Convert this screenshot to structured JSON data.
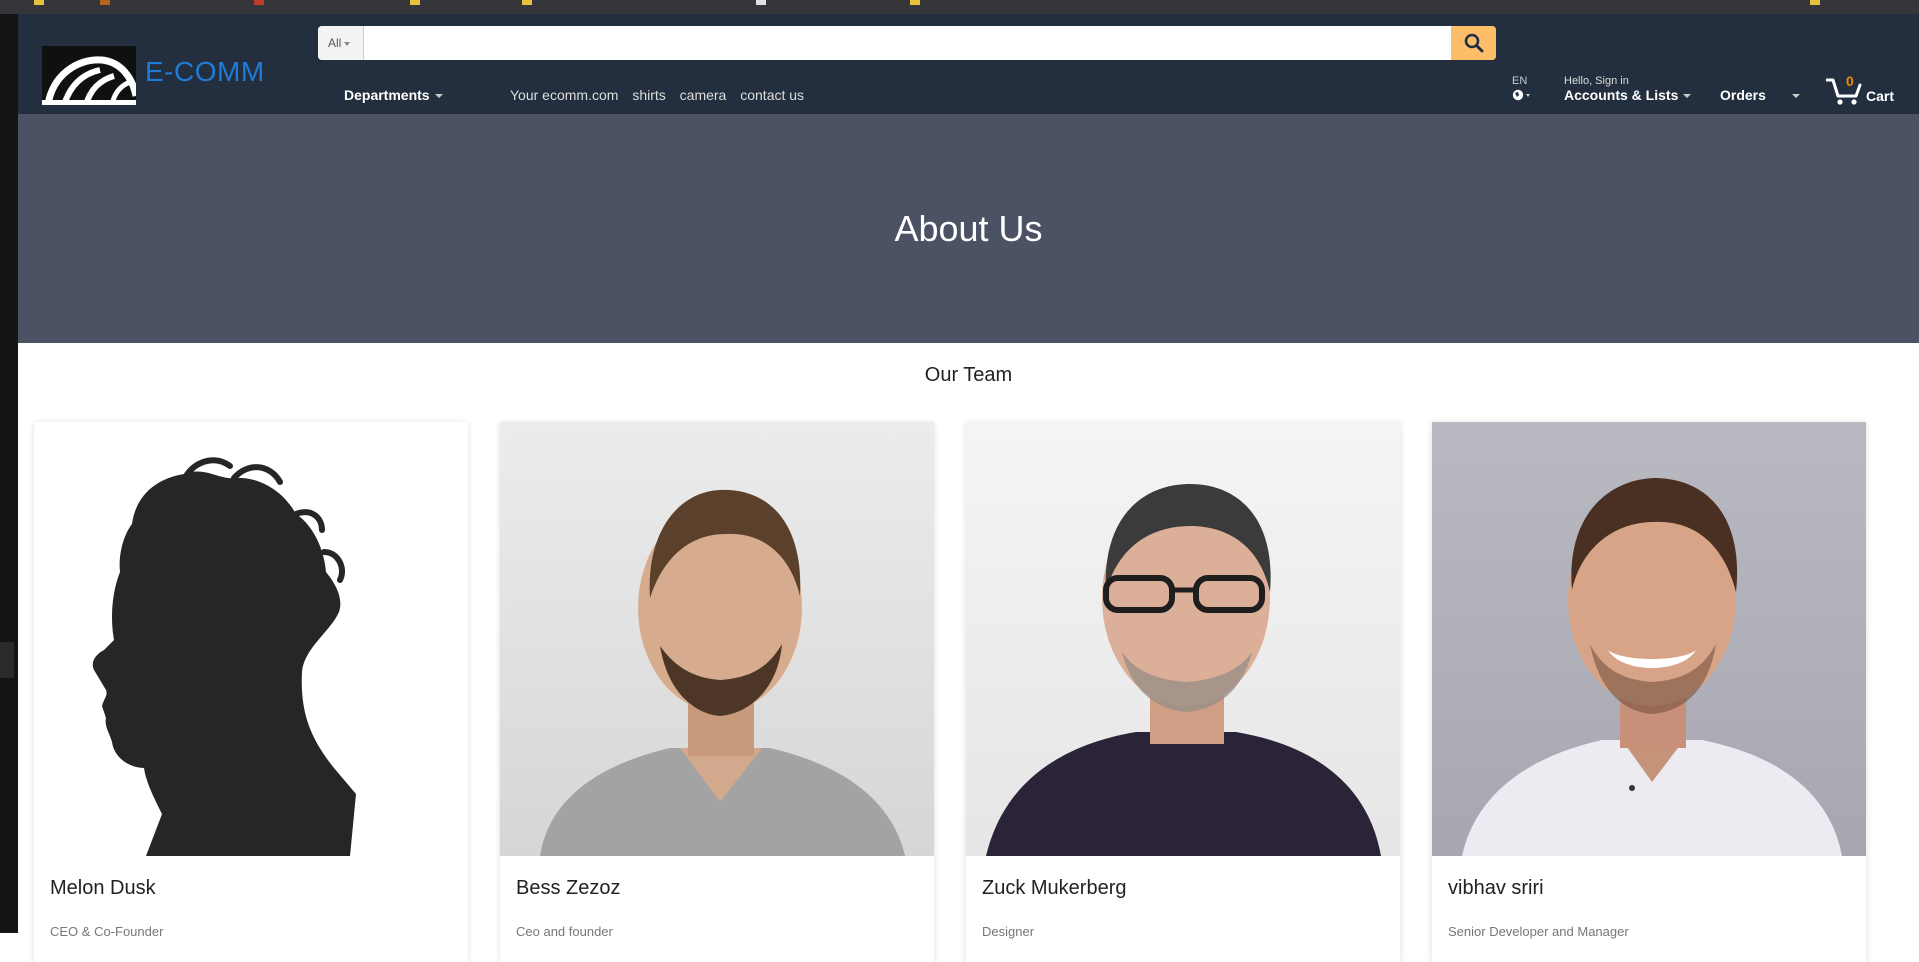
{
  "header": {
    "logo_text": "E-COMM",
    "search": {
      "category": "All",
      "placeholder": "",
      "value": ""
    },
    "departments_label": "Departments",
    "nav_links": [
      "Your ecomm.com",
      "shirts",
      "camera",
      "contact us"
    ],
    "language": "EN",
    "greeting": "Hello, Sign in",
    "accounts_label": "Accounts & Lists",
    "orders_label": "Orders",
    "cart_count": "0",
    "cart_label": "Cart"
  },
  "hero": {
    "title": "About Us"
  },
  "team": {
    "heading": "Our Team",
    "members": [
      {
        "name": "Melon Dusk",
        "role": "CEO & Co-Founder"
      },
      {
        "name": "Bess Zezoz",
        "role": "Ceo and founder"
      },
      {
        "name": "Zuck Mukerberg",
        "role": "Designer"
      },
      {
        "name": "vibhav sriri",
        "role": "Senior Developer and Manager"
      }
    ]
  },
  "colors": {
    "header_bg": "#232f3e",
    "hero_bg": "#4a5263",
    "search_button": "#febd69",
    "logo_text": "#1f7bd8",
    "cart_count": "#f08804"
  },
  "icons": [
    "search-icon",
    "globe-icon",
    "cart-icon",
    "logo-icon"
  ]
}
